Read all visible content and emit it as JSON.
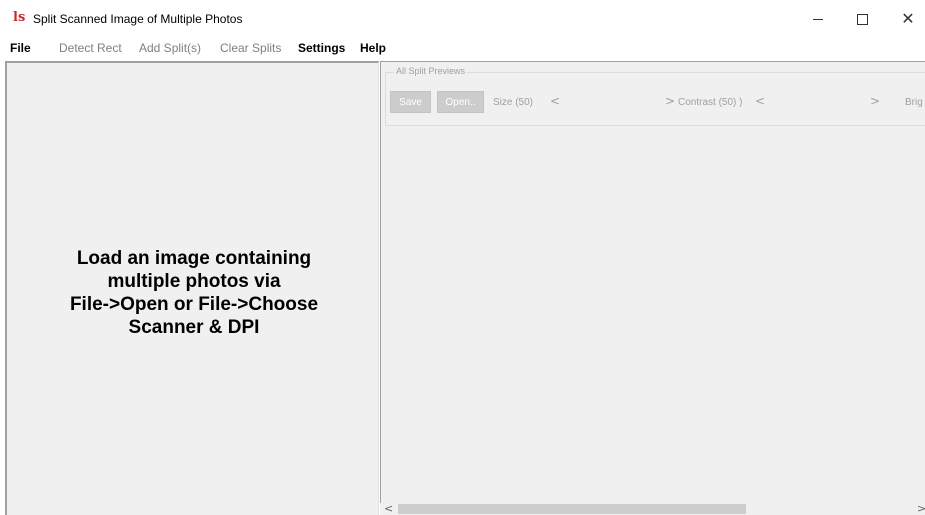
{
  "window": {
    "title": "Split Scanned Image of Multiple Photos",
    "icon": "ls",
    "minimize_glyph": "minimize-icon",
    "maximize_glyph": "maximize-icon",
    "close_glyph": "✕"
  },
  "menu": {
    "items": [
      {
        "label": "File",
        "enabled": true
      },
      {
        "label": "Detect Rect",
        "enabled": false
      },
      {
        "label": "Add Split(s)",
        "enabled": false
      },
      {
        "label": "Clear Splits",
        "enabled": false
      },
      {
        "label": "Settings",
        "enabled": true
      },
      {
        "label": "Help",
        "enabled": true
      }
    ]
  },
  "left_pane": {
    "message": "Load an image containing\nmultiple photos via\nFile->Open or File->Choose\nScanner & DPI"
  },
  "previews": {
    "group_title": "All Split Previews",
    "save_label": "Save",
    "open_label": "Open..",
    "size_label": "Size (50)",
    "contrast_label": "Contrast (50) )",
    "brightness_label": "Brig",
    "left_arrow": "<",
    "right_arrow": ">"
  },
  "scrollbar": {
    "left_arrow": "<",
    "right_arrow": ">"
  },
  "colors": {
    "app_icon": "#c8282a",
    "pane_bg": "#f0f0f0",
    "disabled_text": "#808080"
  }
}
